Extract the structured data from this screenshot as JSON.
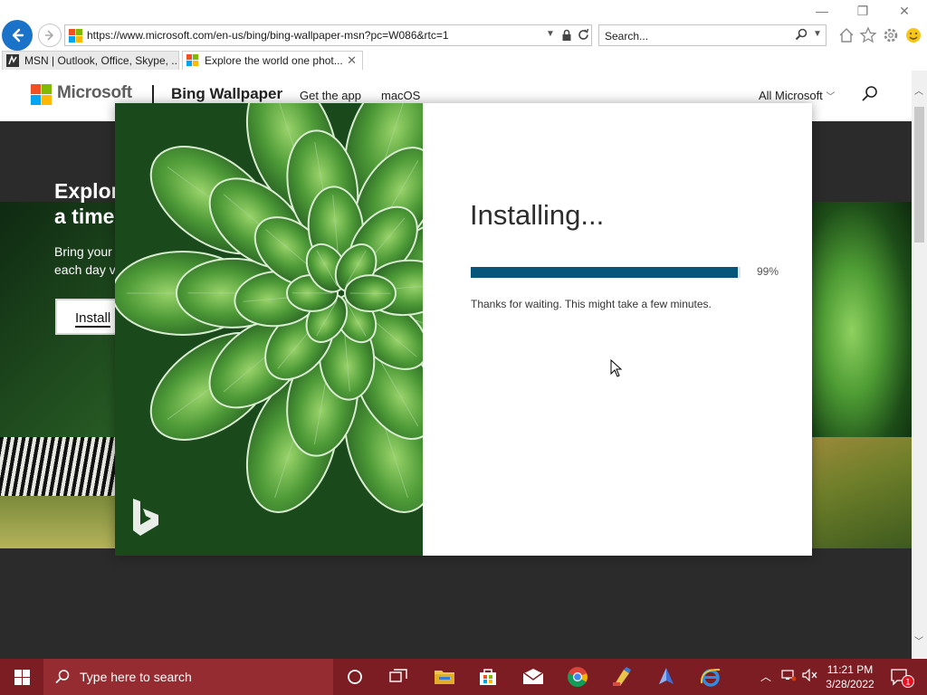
{
  "browser": {
    "address_url": "https://www.microsoft.com/en-us/bing/bing-wallpaper-msn?pc=W086&rtc=1",
    "search_placeholder": "Search...",
    "tabs": [
      {
        "label": "MSN | Outlook, Office, Skype, ..."
      },
      {
        "label": "Explore the world one phot..."
      }
    ]
  },
  "site_nav": {
    "brand": "Microsoft",
    "product": "Bing Wallpaper",
    "links": [
      "Get the app",
      "macOS"
    ],
    "all_microsoft": "All Microsoft"
  },
  "hero": {
    "heading": "Explor\na time",
    "body": "Bring your\neach day v",
    "button": "Install"
  },
  "installer": {
    "title": "Installing...",
    "progress_percent": 99,
    "progress_label": "99%",
    "message": "Thanks for waiting. This might take a few minutes."
  },
  "taskbar": {
    "search_placeholder": "Type here to search",
    "time": "11:21 PM",
    "date": "3/28/2022",
    "notification_count": "1"
  },
  "colors": {
    "accent_blue": "#1a73c8",
    "progress_fill": "#07557a",
    "taskbar_bg": "#7b1d22",
    "taskbar_search_bg": "#942c31"
  },
  "icons": {
    "browser": [
      "back-icon",
      "forward-icon",
      "lock-icon",
      "refresh-icon",
      "search-icon",
      "home-icon",
      "favorites-star-icon",
      "settings-gear-icon",
      "smiley-feedback-icon"
    ],
    "taskbar": [
      "windows-start-icon",
      "search-icon",
      "cortana-icon",
      "task-view-icon",
      "file-explorer-icon",
      "store-icon",
      "mail-icon",
      "chrome-icon",
      "paint-icon",
      "app-icon",
      "internet-explorer-icon"
    ]
  }
}
